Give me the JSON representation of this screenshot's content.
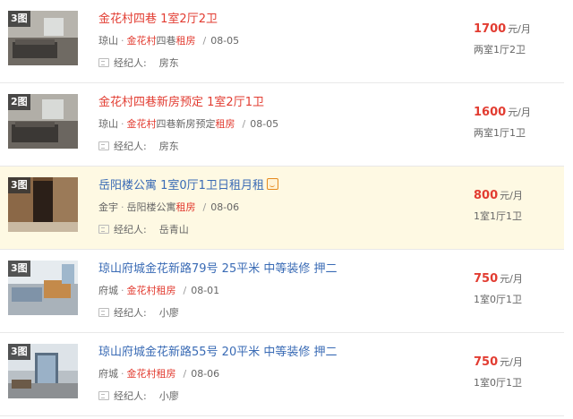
{
  "listings": [
    {
      "photo_count": "3图",
      "title_parts": [
        {
          "text": "金花村",
          "color": "red"
        },
        {
          "text": "四巷 1室2厅2卫",
          "color": "red"
        }
      ],
      "district": "琼山",
      "sep_dot": "·",
      "community": "金花村",
      "community_rest": "四巷",
      "rent_tag": "租房",
      "slash": "/",
      "date": "08-05",
      "agent_label": "经纪人:",
      "agent_name": "房东",
      "price": "1700",
      "price_unit": "元/月",
      "layout": "两室1厅2卫",
      "highlight": false
    },
    {
      "photo_count": "2图",
      "title_parts": [
        {
          "text": "金花村",
          "color": "red"
        },
        {
          "text": "四巷新房预定 1室2厅1卫",
          "color": "red"
        }
      ],
      "district": "琼山",
      "sep_dot": "·",
      "community": "金花村",
      "community_rest": "四巷新房预定",
      "rent_tag": "租房",
      "slash": "/",
      "date": "08-05",
      "agent_label": "经纪人:",
      "agent_name": "房东",
      "price": "1600",
      "price_unit": "元/月",
      "layout": "两室1厅1卫",
      "highlight": false
    },
    {
      "photo_count": "3图",
      "title_parts": [
        {
          "text": "岳阳楼公寓 1室0厅1卫日租月租",
          "color": "blue"
        }
      ],
      "district": "金宇",
      "sep_dot": "·",
      "community": "",
      "community_rest": "岳阳楼公寓",
      "rent_tag": "租房",
      "slash": "/",
      "date": "08-06",
      "agent_label": "经纪人:",
      "agent_name": "岳青山",
      "price": "800",
      "price_unit": "元/月",
      "layout": "1室1厅1卫",
      "highlight": true
    },
    {
      "photo_count": "3图",
      "title_parts": [
        {
          "text": "琼山府城金花新路79号 25平米 中等装修 押二",
          "color": "blue"
        }
      ],
      "district": "府城",
      "sep_dot": "·",
      "community": "金花村",
      "community_rest": "",
      "rent_tag": "租房",
      "slash": "/",
      "date": "08-01",
      "agent_label": "经纪人:",
      "agent_name": "小廖",
      "price": "750",
      "price_unit": "元/月",
      "layout": "1室0厅1卫",
      "highlight": false
    },
    {
      "photo_count": "3图",
      "title_parts": [
        {
          "text": "琼山府城金花新路55号 20平米 中等装修 押二",
          "color": "blue"
        }
      ],
      "district": "府城",
      "sep_dot": "·",
      "community": "金花村",
      "community_rest": "",
      "rent_tag": "租房",
      "slash": "/",
      "date": "08-06",
      "agent_label": "经纪人:",
      "agent_name": "小廖",
      "price": "750",
      "price_unit": "元/月",
      "layout": "1室0厅1卫",
      "highlight": false
    }
  ],
  "colors": {
    "accent_red": "#e23c31",
    "title_blue": "#3a6bb5",
    "highlight_bg": "#fef9e3"
  }
}
